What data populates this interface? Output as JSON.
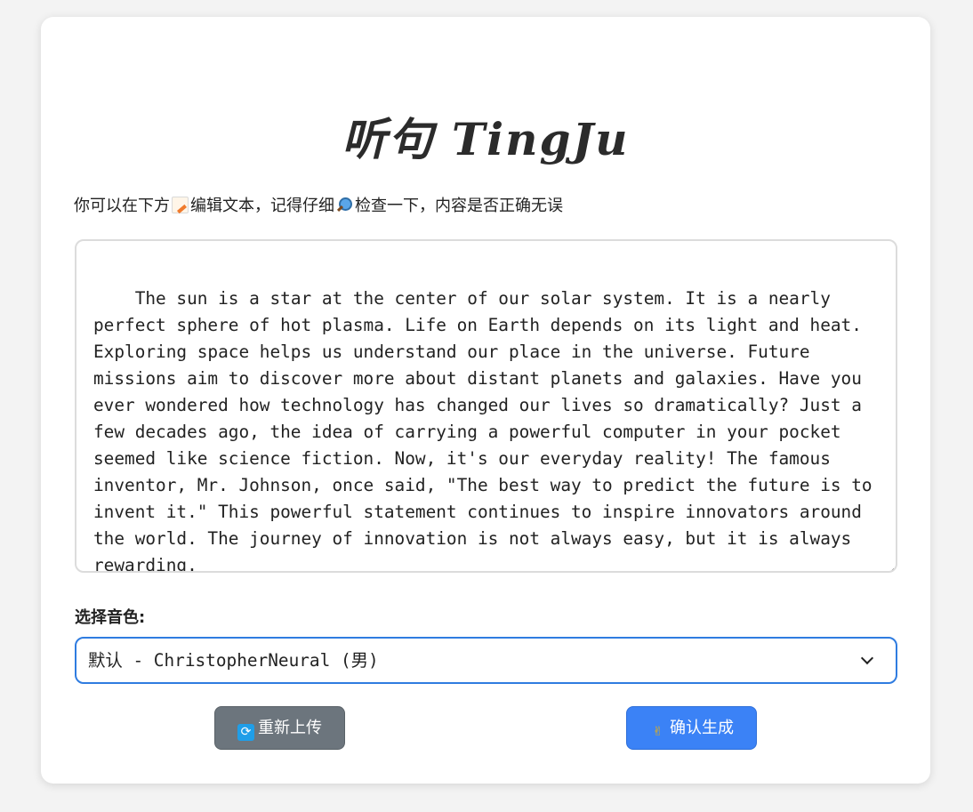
{
  "app": {
    "title": "听句 TingJu"
  },
  "instruction": {
    "part1": "你可以在下方",
    "memo_icon": "memo-icon",
    "part2": "编辑文本，记得仔细",
    "magnifier_icon": "magnifier-icon",
    "part3": "检查一下，内容是否正确无误"
  },
  "editor": {
    "value": "The sun is a star at the center of our solar system. It is a nearly perfect sphere of hot plasma. Life on Earth depends on its light and heat. Exploring space helps us understand our place in the universe. Future missions aim to discover more about distant planets and galaxies. Have you ever wondered how technology has changed our lives so dramatically? Just a few decades ago, the idea of carrying a powerful computer in your pocket seemed like science fiction. Now, it's our everyday reality! The famous inventor, Mr. Johnson, once said, \"The best way to predict the future is to invent it.\" This powerful statement continues to inspire innovators around the world. The journey of innovation is not always easy, but it is always rewarding."
  },
  "voice": {
    "label": "选择音色:",
    "selected": "默认 - ChristopherNeural (男)"
  },
  "buttons": {
    "reupload": {
      "icon": "refresh-icon",
      "label": "重新上传"
    },
    "confirm": {
      "icon": "ok-hand-icon",
      "label": "确认生成"
    }
  },
  "colors": {
    "primary": "#3b82f6",
    "secondary": "#6c757d",
    "focus_border": "#2f7ce0"
  }
}
